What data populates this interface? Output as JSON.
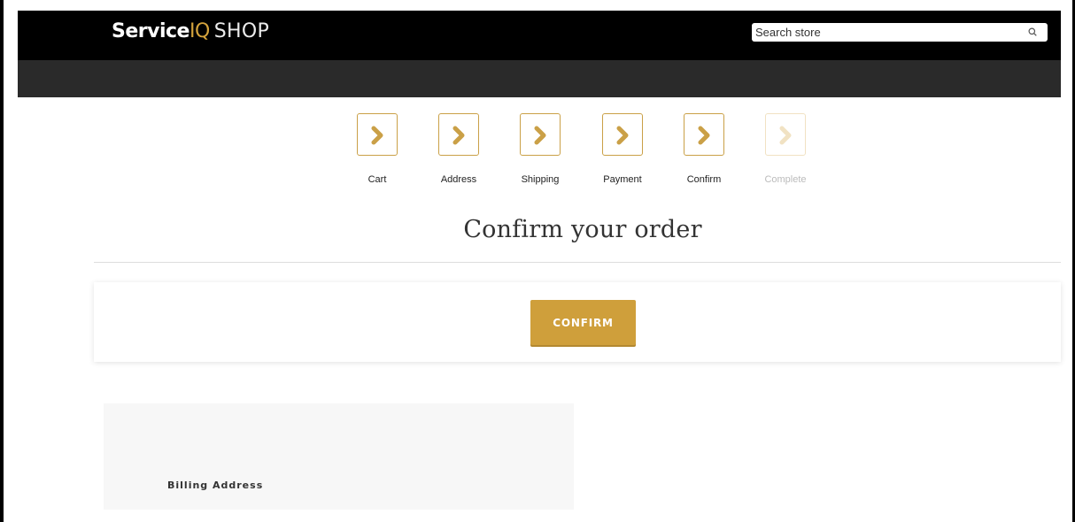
{
  "header": {
    "logo": {
      "part1": "Service",
      "part2": "IQ",
      "part3": "SHOP"
    },
    "search": {
      "placeholder": "Search store",
      "icon": "search-icon"
    }
  },
  "colors": {
    "accent": "#cf9f3b",
    "topbar": "#000000",
    "navbar": "#2a2a2a",
    "step_border": "#caa047",
    "step_border_disabled": "#f1e2c3"
  },
  "steps": [
    {
      "label": "Cart",
      "state": "done",
      "icon": "chevron-right-icon"
    },
    {
      "label": "Address",
      "state": "done",
      "icon": "chevron-right-icon"
    },
    {
      "label": "Shipping",
      "state": "done",
      "icon": "chevron-right-icon"
    },
    {
      "label": "Payment",
      "state": "done",
      "icon": "chevron-right-icon"
    },
    {
      "label": "Confirm",
      "state": "current",
      "icon": "chevron-right-icon"
    },
    {
      "label": "Complete",
      "state": "disabled",
      "icon": "chevron-right-icon"
    }
  ],
  "main": {
    "title": "Confirm your order",
    "confirm_label": "CONFIRM",
    "billing_heading": "Billing Address"
  }
}
